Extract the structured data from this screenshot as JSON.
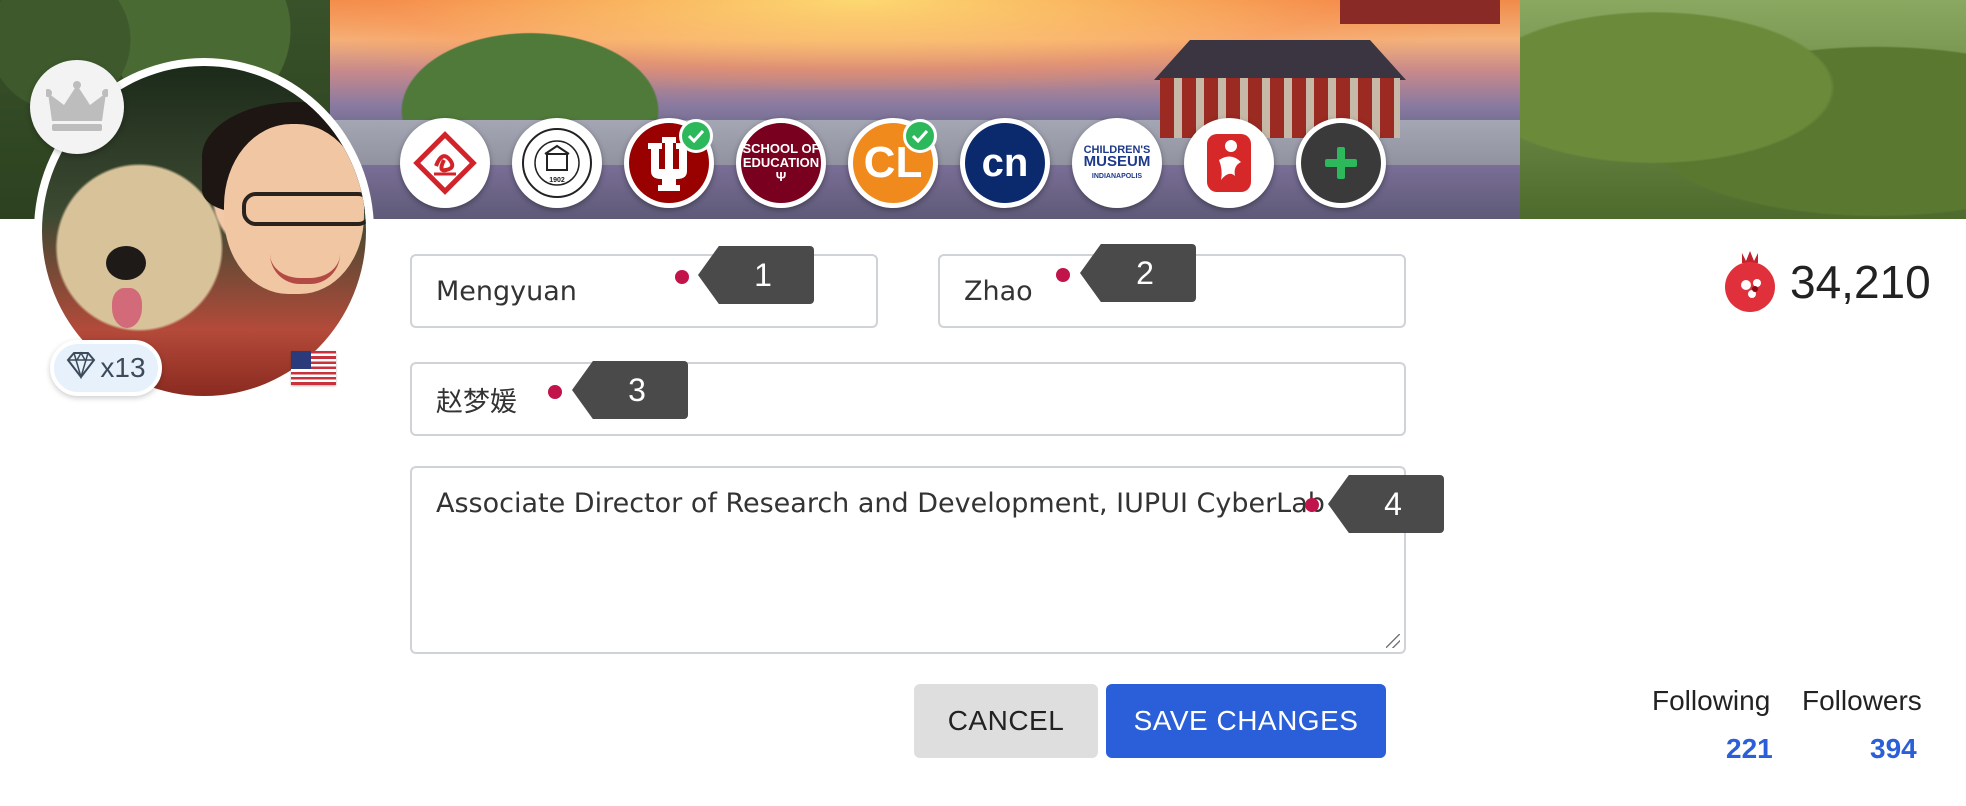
{
  "profile": {
    "first_name": "Mengyuan",
    "last_name": "Zhao",
    "native_name": "赵梦媛",
    "title": "Associate Director of Research and Development, IUPUI CyberLab",
    "diamond_count": "x13",
    "flag": "us-flag-icon"
  },
  "callouts": [
    "1",
    "2",
    "3",
    "4"
  ],
  "badges": [
    {
      "name": "diamond-logo-badge",
      "verified": false
    },
    {
      "name": "beijing-normal-university-badge",
      "text": "BEIJING NORMAL UNIVERSITY 1902",
      "verified": false
    },
    {
      "name": "indiana-university-badge",
      "verified": true
    },
    {
      "name": "school-of-education-badge",
      "text": "SCHOOL OF EDUCATION",
      "verified": false
    },
    {
      "name": "cyberlab-badge",
      "text": "CL",
      "verified": true
    },
    {
      "name": "cn-badge",
      "text": "cn",
      "verified": false
    },
    {
      "name": "childrens-museum-badge",
      "text": "CHILDREN'S MUSEUM INDIANAPOLIS",
      "verified": false
    },
    {
      "name": "beijing-olympics-badge",
      "verified": false
    },
    {
      "name": "add-badge-button",
      "icon": "plus-icon"
    }
  ],
  "buttons": {
    "cancel": "CANCEL",
    "save": "SAVE CHANGES"
  },
  "stats": {
    "points": "34,210",
    "following_label": "Following",
    "following_count": "221",
    "followers_label": "Followers",
    "followers_count": "394"
  },
  "colors": {
    "primary": "#2b5fd9",
    "required_dot": "#c0144a",
    "verified": "#2eb85c",
    "pomegranate": "#e0303c"
  }
}
